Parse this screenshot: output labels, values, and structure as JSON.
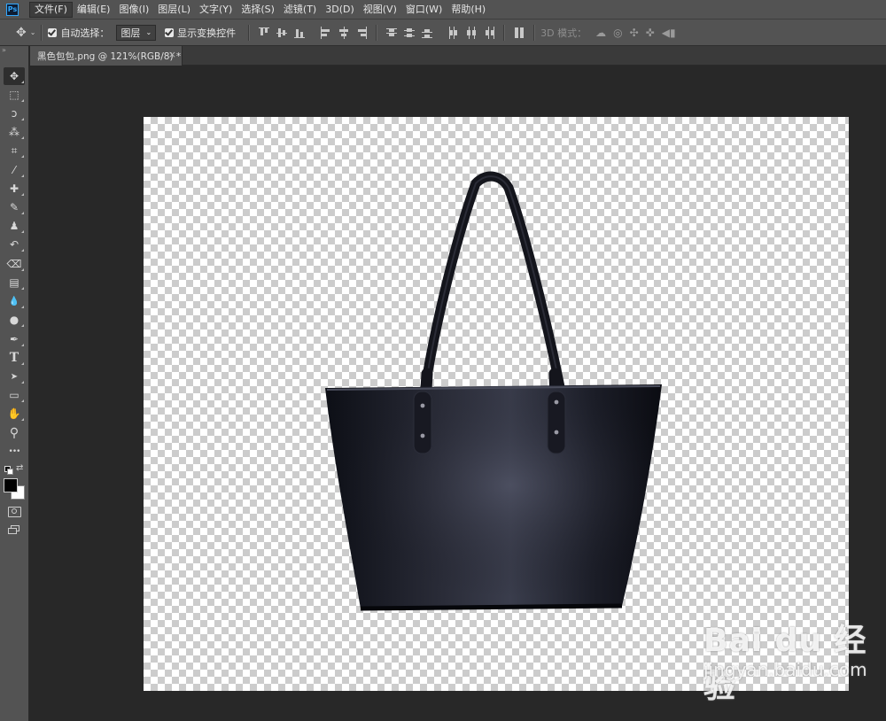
{
  "app": {
    "logo_text": "Ps"
  },
  "menu": [
    {
      "label": "文件(F)",
      "active": true
    },
    {
      "label": "编辑(E)"
    },
    {
      "label": "图像(I)"
    },
    {
      "label": "图层(L)"
    },
    {
      "label": "文字(Y)"
    },
    {
      "label": "选择(S)"
    },
    {
      "label": "滤镜(T)"
    },
    {
      "label": "3D(D)"
    },
    {
      "label": "视图(V)"
    },
    {
      "label": "窗口(W)"
    },
    {
      "label": "帮助(H)"
    }
  ],
  "options": {
    "auto_select_label": "自动选择：",
    "auto_select_checked": true,
    "target_value": "图层",
    "show_transform_label": "显示变换控件",
    "show_transform_checked": true,
    "mode_label": "3D 模式："
  },
  "document": {
    "tab_title": "黑色包包.png @ 121%(RGB/8) *",
    "close_glyph": "×",
    "image_subject": "black leather tote bag on transparent background"
  },
  "watermark": {
    "brand": "Bai du 经验",
    "url": "jingyan.baidu.com"
  },
  "toolbox": {
    "grip": "»",
    "tools": [
      {
        "name": "move-tool",
        "glyph": "✥",
        "active": true
      },
      {
        "name": "marquee-tool",
        "glyph": "⬚"
      },
      {
        "name": "lasso-tool",
        "glyph": "ↄ"
      },
      {
        "name": "magic-wand-tool",
        "glyph": "⁂"
      },
      {
        "name": "crop-tool",
        "glyph": "⌗"
      },
      {
        "name": "eyedropper-tool",
        "glyph": "⁄"
      },
      {
        "name": "healing-brush-tool",
        "glyph": "✚"
      },
      {
        "name": "brush-tool",
        "glyph": "✎"
      },
      {
        "name": "clone-stamp-tool",
        "glyph": "♟"
      },
      {
        "name": "history-brush-tool",
        "glyph": "↶"
      },
      {
        "name": "eraser-tool",
        "glyph": "⌫"
      },
      {
        "name": "gradient-tool",
        "glyph": "▤"
      },
      {
        "name": "blur-tool",
        "glyph": "💧"
      },
      {
        "name": "dodge-tool",
        "glyph": "●"
      },
      {
        "name": "pen-tool",
        "glyph": "✒"
      },
      {
        "name": "type-tool",
        "glyph": "T"
      },
      {
        "name": "path-selection-tool",
        "glyph": "➤"
      },
      {
        "name": "rectangle-tool",
        "glyph": "▭"
      },
      {
        "name": "hand-tool",
        "glyph": "✋"
      },
      {
        "name": "zoom-tool",
        "glyph": "⚲"
      },
      {
        "name": "more-tools",
        "glyph": "•••"
      }
    ]
  },
  "colors": {
    "foreground": "#000000",
    "background": "#ffffff"
  }
}
